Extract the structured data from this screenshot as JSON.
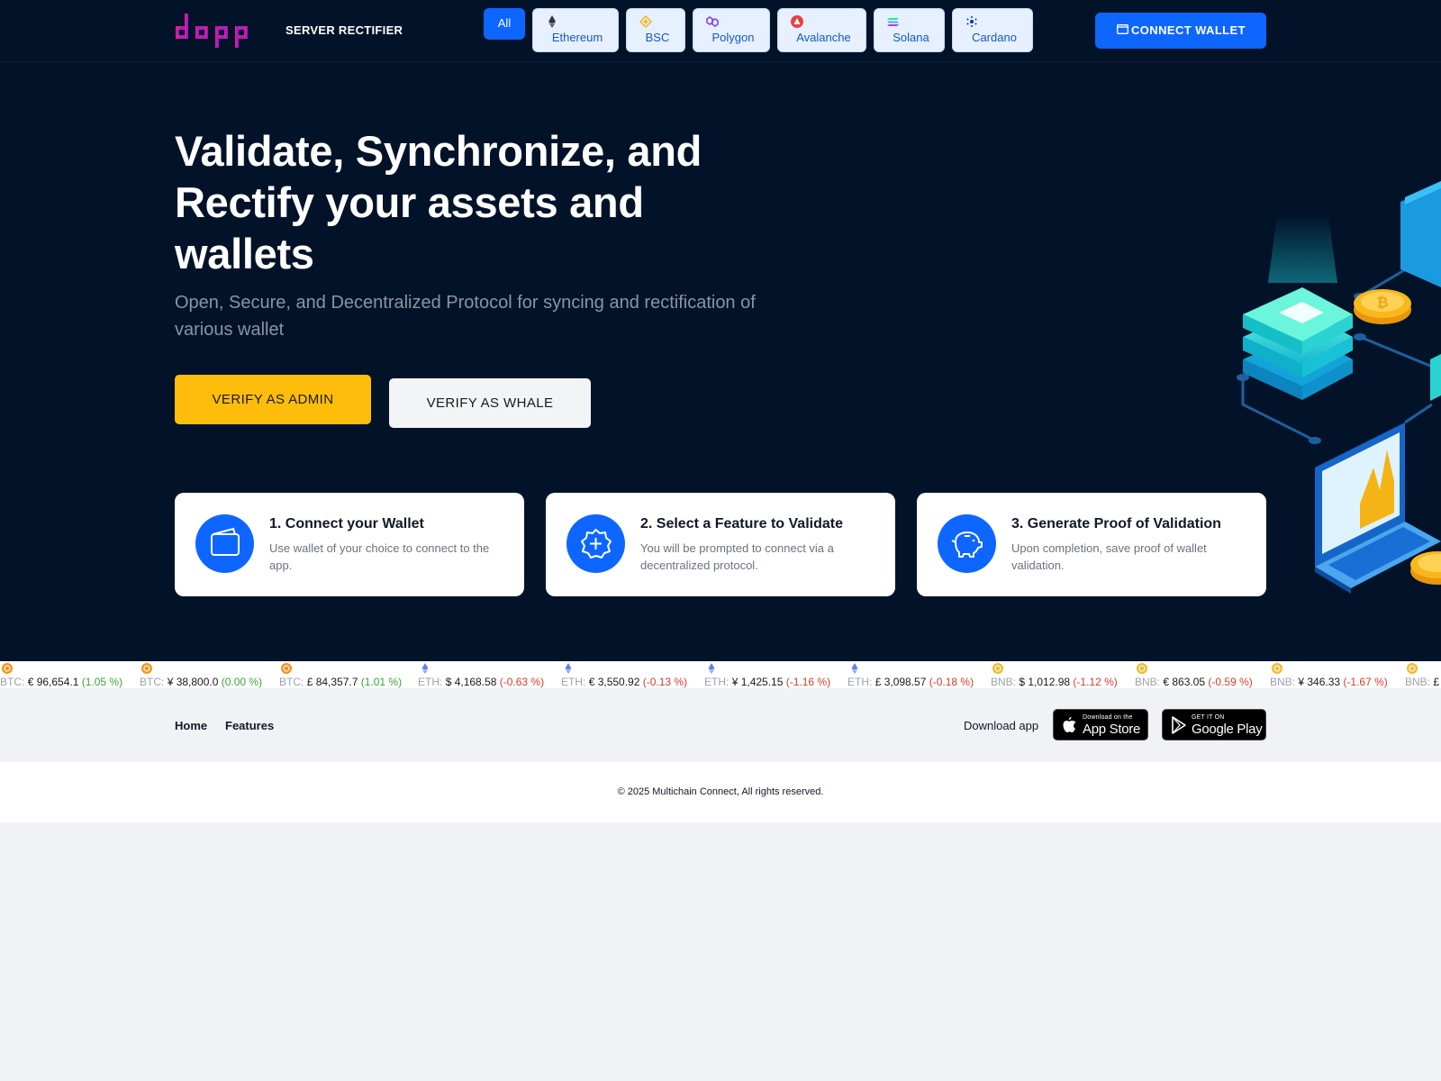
{
  "header": {
    "logo_text": "dapp",
    "brand": "SERVER RECTIFIER",
    "chains": [
      {
        "label": "All",
        "active": true
      },
      {
        "label": "Ethereum",
        "icon": "ethereum-icon"
      },
      {
        "label": "BSC",
        "icon": "bnb-icon"
      },
      {
        "label": "Polygon",
        "icon": "polygon-icon"
      },
      {
        "label": "Avalanche",
        "icon": "avalanche-icon"
      },
      {
        "label": "Solana",
        "icon": "solana-icon"
      },
      {
        "label": "Cardano",
        "icon": "cardano-icon"
      }
    ],
    "connect_label": "CONNECT WALLET"
  },
  "hero": {
    "title": "Validate, Synchronize, and Rectify your assets and wallets",
    "subtitle": "Open, Secure, and Decentralized Protocol for syncing and rectification of various wallet",
    "admin_button": "VERIFY AS ADMIN",
    "whale_button": "VERIFY AS WHALE"
  },
  "steps": [
    {
      "title": "1. Connect your Wallet",
      "desc": "Use wallet of your choice to connect to the app.",
      "icon": "wallet-icon"
    },
    {
      "title": "2. Select a Feature to Validate",
      "desc": "You will be prompted to connect via a decentralized protocol.",
      "icon": "badge-plus-icon"
    },
    {
      "title": "3. Generate Proof of Validation",
      "desc": "Upon completion, save proof of wallet validation.",
      "icon": "piggy-bank-icon"
    }
  ],
  "ticker": [
    {
      "sym": "BTC:",
      "val": "€ 96,654.1",
      "chg": "(1.05 %)",
      "dir": "up",
      "coin": "btc"
    },
    {
      "sym": "BTC:",
      "val": "¥ 38,800.0",
      "chg": "(0.00 %)",
      "dir": "up",
      "coin": "btc"
    },
    {
      "sym": "BTC:",
      "val": "£ 84,357.7",
      "chg": "(1.01 %)",
      "dir": "up",
      "coin": "btc"
    },
    {
      "sym": "ETH:",
      "val": "$ 4,168.58",
      "chg": "(-0.63 %)",
      "dir": "down",
      "coin": "eth"
    },
    {
      "sym": "ETH:",
      "val": "€ 3,550.92",
      "chg": "(-0.13 %)",
      "dir": "down",
      "coin": "eth"
    },
    {
      "sym": "ETH:",
      "val": "¥ 1,425.15",
      "chg": "(-1.16 %)",
      "dir": "down",
      "coin": "eth"
    },
    {
      "sym": "ETH:",
      "val": "£ 3,098.57",
      "chg": "(-0.18 %)",
      "dir": "down",
      "coin": "eth"
    },
    {
      "sym": "BNB:",
      "val": "$ 1,012.98",
      "chg": "(-1.12 %)",
      "dir": "down",
      "coin": "bnb"
    },
    {
      "sym": "BNB:",
      "val": "€ 863.05",
      "chg": "(-0.59 %)",
      "dir": "down",
      "coin": "bnb"
    },
    {
      "sym": "BNB:",
      "val": "¥ 346.33",
      "chg": "(-1.67 %)",
      "dir": "down",
      "coin": "bnb"
    },
    {
      "sym": "BNB:",
      "val": "£",
      "chg": "",
      "dir": "down",
      "coin": "bnb"
    }
  ],
  "footer": {
    "nav": [
      "Home",
      "Features"
    ],
    "download_label": "Download app",
    "app_store_small": "Download on the",
    "app_store_big": "App Store",
    "google_play_small": "GET IT ON",
    "google_play_big": "Google Play",
    "copyright": "© 2025 Multichain Connect, All rights reserved."
  },
  "colors": {
    "header_bg": "#021329",
    "accent_blue": "#0d66ff",
    "admin_yellow": "#fdbd0a",
    "positive": "#3aa53a",
    "negative": "#d63b2f"
  }
}
